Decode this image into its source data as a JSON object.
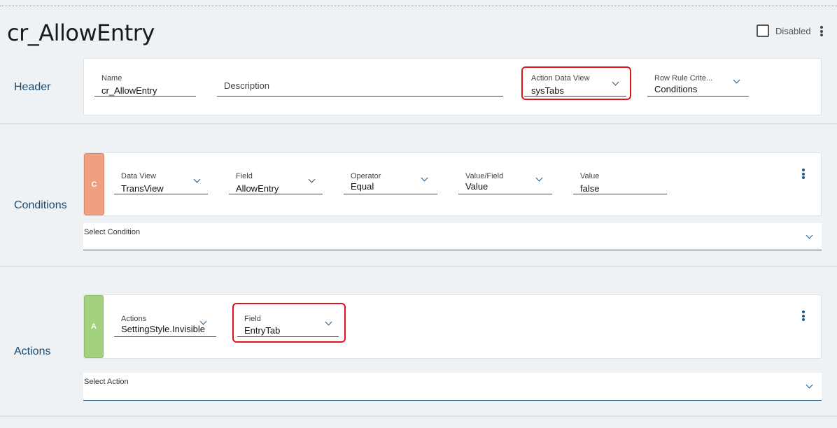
{
  "page": {
    "title": "cr_AllowEntry",
    "disabled_label": "Disabled"
  },
  "header": {
    "label": "Header",
    "name_label": "Name",
    "name_value": "cr_AllowEntry",
    "description_placeholder": "Description",
    "action_data_view_label": "Action Data View",
    "action_data_view_value": "sysTabs",
    "row_rule_label": "Row Rule Crite...",
    "row_rule_value": "Conditions"
  },
  "conditions": {
    "label": "Conditions",
    "badge": "C",
    "badge_color": "#f0a080",
    "row": {
      "data_view_label": "Data View",
      "data_view_value": "TransView",
      "field_label": "Field",
      "field_value": "AllowEntry",
      "operator_label": "Operator",
      "operator_value": "Equal",
      "value_field_label": "Value/Field",
      "value_field_value": "Value",
      "value_label": "Value",
      "value_value": "false"
    },
    "select_label": "Select Condition"
  },
  "actions": {
    "label": "Actions",
    "badge": "A",
    "badge_color": "#a3d17f",
    "row": {
      "actions_label": "Actions",
      "actions_value": "SettingStyle.Invisible",
      "field_label": "Field",
      "field_value": "EntryTab"
    },
    "select_label": "Select Action"
  },
  "colors": {
    "accent": "#1e5a88",
    "highlight": "#e0141e",
    "section_text": "#1a4a6e"
  }
}
